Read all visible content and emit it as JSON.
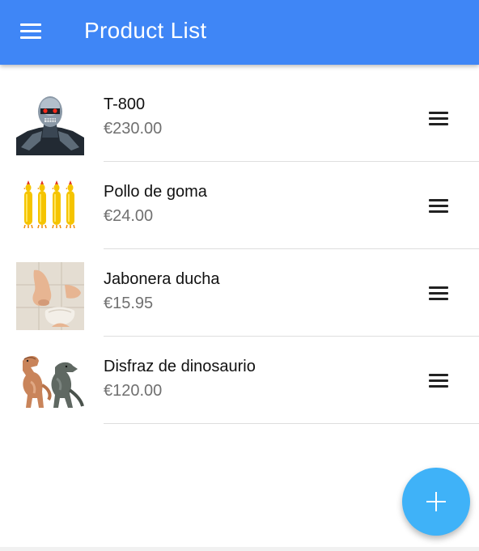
{
  "header": {
    "title": "Product List",
    "menu_icon": "hamburger-menu-icon",
    "background_color": "#3f86f6"
  },
  "products": [
    {
      "name": "T-800",
      "price": "€230.00",
      "image": "terminator-robot-image"
    },
    {
      "name": "Pollo de goma",
      "price": "€24.00",
      "image": "rubber-chicken-image"
    },
    {
      "name": "Jabonera ducha",
      "price": "€15.95",
      "image": "nose-soap-dish-image"
    },
    {
      "name": "Disfraz de dinosaurio",
      "price": "€120.00",
      "image": "dinosaur-costume-image"
    }
  ],
  "item_action_icon": "reorder-icon",
  "fab": {
    "icon": "plus-icon",
    "color": "#3fb2f8"
  }
}
